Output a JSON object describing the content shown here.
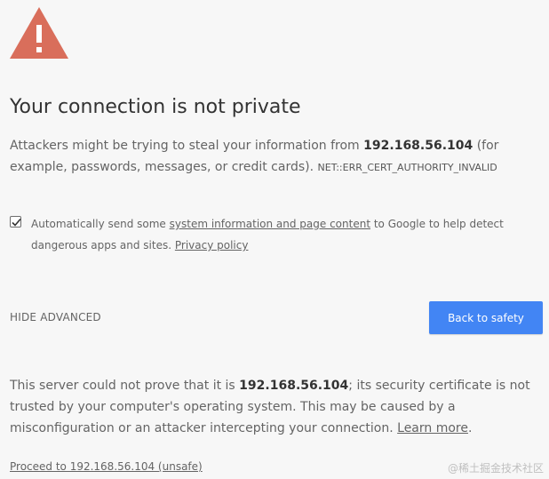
{
  "warning_icon": "warning-triangle-icon",
  "colors": {
    "warning_icon": "#d96e5b",
    "button_bg": "#4285f4",
    "background": "#f7f7f7"
  },
  "title": "Your connection is not private",
  "intro": {
    "text_before": "Attackers might be trying to steal your information from ",
    "host": "192.168.56.104",
    "text_after": " (for example, passwords, messages, or credit cards). ",
    "error_code": "NET::ERR_CERT_AUTHORITY_INVALID"
  },
  "report": {
    "checked": true,
    "text_before": "Automatically send some ",
    "link_text": "system information and page content",
    "text_middle": " to Google to help detect dangerous apps and sites. ",
    "privacy_link": "Privacy policy"
  },
  "hide_advanced_label": "HIDE ADVANCED",
  "back_button_label": "Back to safety",
  "details": {
    "text_before": "This server could not prove that it is ",
    "host": "192.168.56.104",
    "text_after": "; its security certificate is not trusted by your computer's operating system. This may be caused by a misconfiguration or an attacker intercepting your connection. ",
    "learn_more": "Learn more",
    "period": "."
  },
  "proceed_link": "Proceed to 192.168.56.104 (unsafe)",
  "watermark": "@稀土掘金技术社区"
}
